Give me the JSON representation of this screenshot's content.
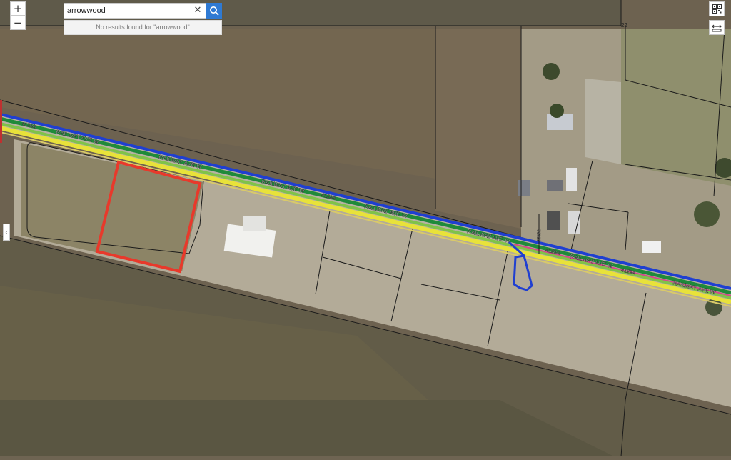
{
  "search": {
    "value": "arrowwood",
    "placeholder": "",
    "no_results": "No results found for \"arrowwood\""
  },
  "controls": {
    "zoom_in": "+",
    "zoom_out": "−",
    "clear": "✕",
    "collapse": "‹"
  },
  "map": {
    "labels": {
      "railway_1": "RAILWAY AVE W",
      "railway_2": "RAILWAY AVE W",
      "railway_3": "RAILWAY AVE W",
      "railway_4": "RAILWAY AVE W",
      "railway_5": "RAILWAY AVE W",
      "railway_6": "RAILWAY AVE W",
      "railway_7": "RAILWAY AVE W",
      "route_1": "4129A",
      "route_2": "4129A",
      "route_3": "4129A",
      "route_4": "4129A",
      "side_road": "65482",
      "parcel_num": "22"
    },
    "colors": {
      "highlight": "#e8392b",
      "road_blue": "#1f3fd1",
      "road_green": "#1f8a3a",
      "road_yellow": "#e8e23a",
      "marker": "#1f3fd1"
    }
  }
}
